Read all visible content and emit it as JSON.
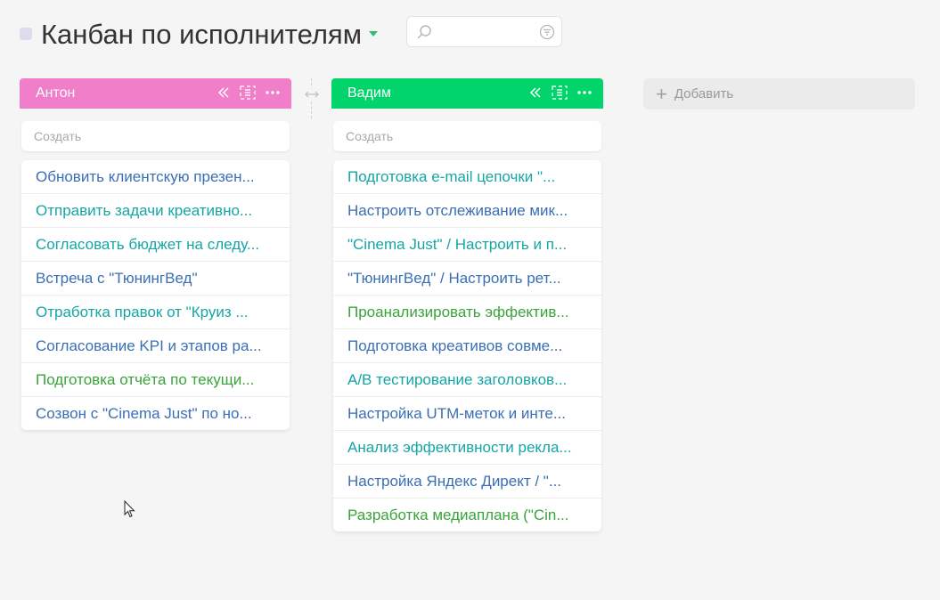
{
  "board": {
    "title": "Канбан по исполнителям",
    "search": {
      "placeholder": "",
      "value": ""
    }
  },
  "add_column": {
    "label": "Добавить",
    "icon": "plus-icon"
  },
  "columns": [
    {
      "name": "Антон",
      "color": "#f07ec9",
      "create_label": "Создать",
      "tasks": [
        {
          "text": "Обновить клиентскую презен...",
          "color": "#3a6fb4"
        },
        {
          "text": "Отправить задачи креативно...",
          "color": "#16a5a5"
        },
        {
          "text": "Согласовать бюджет на следу...",
          "color": "#16a5a5"
        },
        {
          "text": "Встреча с \"ТюнингВед\"",
          "color": "#3a6fb4"
        },
        {
          "text": "Отработка правок от \"Круиз ...",
          "color": "#16a5a5"
        },
        {
          "text": "Согласование KPI и этапов ра...",
          "color": "#3a6fb4"
        },
        {
          "text": "Подготовка отчёта по текущи...",
          "color": "#3aa33a"
        },
        {
          "text": "Созвон с \"Cinema Just\" по но...",
          "color": "#3a6fb4"
        }
      ]
    },
    {
      "name": "Вадим",
      "color": "#00d46a",
      "create_label": "Создать",
      "tasks": [
        {
          "text": "Подготовка e-mail цепочки \"...",
          "color": "#16a5a5"
        },
        {
          "text": "Настроить отслеживание мик...",
          "color": "#3a6fb4"
        },
        {
          "text": "\"Cinema Just\" / Настроить и п...",
          "color": "#16a5a5"
        },
        {
          "text": "\"ТюнингВед\" / Настроить рет...",
          "color": "#3a6fb4"
        },
        {
          "text": "Проанализировать эффектив...",
          "color": "#3aa33a"
        },
        {
          "text": "Подготовка креативов совме...",
          "color": "#3a6fb4"
        },
        {
          "text": "A/B тестирование заголовков...",
          "color": "#16a5a5"
        },
        {
          "text": "Настройка UTM-меток и инте...",
          "color": "#3a6fb4"
        },
        {
          "text": "Анализ эффективности рекла...",
          "color": "#16a5a5"
        },
        {
          "text": "Настройка Яндекс Директ / \"...",
          "color": "#3a6fb4"
        },
        {
          "text": "Разработка медиаплана (\"Cin...",
          "color": "#3aa33a"
        }
      ]
    }
  ]
}
